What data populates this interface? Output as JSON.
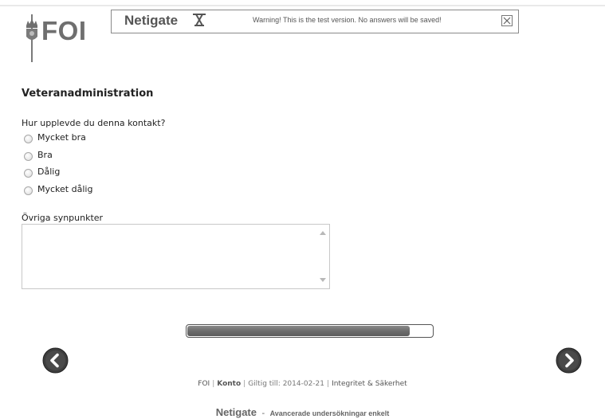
{
  "logo": {
    "text": "FOI"
  },
  "banner": {
    "brand": "Netigate",
    "warning": "Warning! This is the test version. No answers will be saved!"
  },
  "survey": {
    "section_title": "Veteranadministration",
    "question": "Hur upplevde du denna kontakt?",
    "options": [
      "Mycket bra",
      "Bra",
      "Dålig",
      "Mycket dålig"
    ],
    "comments_label": "Övriga synpunkter",
    "comments_value": ""
  },
  "progress": {
    "fraction": 0.91
  },
  "navigation": {
    "prev_icon": "chevron-left-icon",
    "next_icon": "chevron-right-icon"
  },
  "footer": {
    "org": "FOI",
    "account": "Konto",
    "valid_until": "Giltig till: 2014-02-21",
    "privacy": "Integritet & Säkerhet"
  },
  "tagline": {
    "brand": "Netigate",
    "dash": "-",
    "text": "Avancerade undersökningar enkelt"
  },
  "colors": {
    "button_fill": "#444444",
    "progress_fill": "#6b6b6b",
    "logo_gray": "#6f6f6f"
  }
}
